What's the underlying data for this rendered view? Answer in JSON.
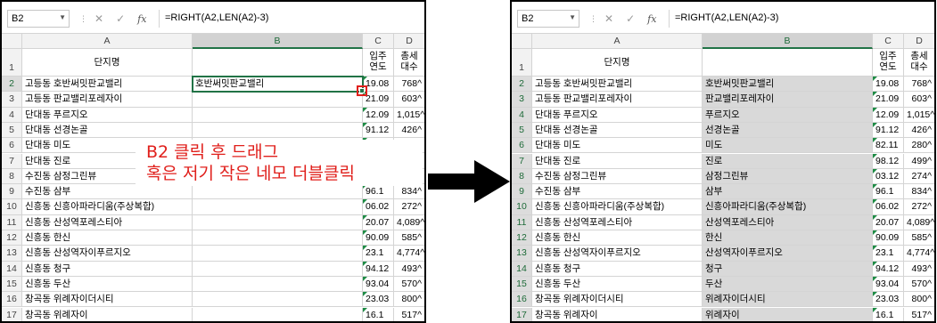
{
  "namebox": "B2",
  "formula": "=RIGHT(A2,LEN(A2)-3)",
  "columns": [
    "A",
    "B",
    "C",
    "D"
  ],
  "header_row": {
    "a": "단지명",
    "b": "",
    "c": "입주\n연도",
    "d": "총세\n대수"
  },
  "rows": [
    {
      "n": "2",
      "a": "고등동 호반써밋판교밸리",
      "b": "호반써밋판교밸리",
      "c": "19.08",
      "d": "768^"
    },
    {
      "n": "3",
      "a": "고등동 판교밸리포레자이",
      "b": "판교밸리포레자이",
      "c": "21.09",
      "d": "603^"
    },
    {
      "n": "4",
      "a": "단대동 푸르지오",
      "b": "푸르지오",
      "c": "12.09",
      "d": "1,015^"
    },
    {
      "n": "5",
      "a": "단대동 선경논골",
      "b": "선경논골",
      "c": "91.12",
      "d": "426^"
    },
    {
      "n": "6",
      "a": "단대동 미도",
      "b": "미도",
      "c": "82.11",
      "d": "280^"
    },
    {
      "n": "7",
      "a": "단대동 진로",
      "b": "진로",
      "c": "98.12",
      "d": "499^"
    },
    {
      "n": "8",
      "a": "수진동 삼정그린뷰",
      "b": "삼정그린뷰",
      "c": "03.12",
      "d": "274^"
    },
    {
      "n": "9",
      "a": "수진동 삼부",
      "b": "삼부",
      "c": "96.1",
      "d": "834^"
    },
    {
      "n": "10",
      "a": "신흥동 신흥아파라디움(주상복합)",
      "b": "신흥아파라디움(주상복합)",
      "c": "06.02",
      "d": "272^"
    },
    {
      "n": "11",
      "a": "신흥동 산성역포레스티아",
      "b": "산성역포레스티아",
      "c": "20.07",
      "d": "4,089^"
    },
    {
      "n": "12",
      "a": "신흥동 한신",
      "b": "한신",
      "c": "90.09",
      "d": "585^"
    },
    {
      "n": "13",
      "a": "신흥동 산성역자이푸르지오",
      "b": "산성역자이푸르지오",
      "c": "23.1",
      "d": "4,774^"
    },
    {
      "n": "14",
      "a": "신흥동 청구",
      "b": "청구",
      "c": "94.12",
      "d": "493^"
    },
    {
      "n": "15",
      "a": "신흥동 두산",
      "b": "두산",
      "c": "93.04",
      "d": "570^"
    },
    {
      "n": "16",
      "a": "창곡동 위례자이더시티",
      "b": "위례자이더시티",
      "c": "23.03",
      "d": "800^"
    },
    {
      "n": "17",
      "a": "창곡동 위례자이",
      "b": "위례자이",
      "c": "16.1",
      "d": "517^"
    }
  ],
  "annotation": {
    "line1": "B2 클릭 후 드래그",
    "line2": "혹은 저기 작은 네모 더블클릭"
  },
  "colors": {
    "accent": "#217346",
    "annotation": "#e0201c",
    "filled": "#d9d9d9"
  },
  "icons": [
    "chevron-down-icon",
    "cancel-icon",
    "enter-icon",
    "function-icon",
    "right-arrow-icon"
  ]
}
